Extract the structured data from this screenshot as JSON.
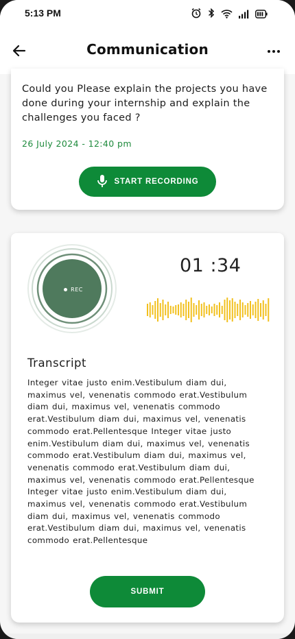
{
  "status_bar": {
    "time": "5:13 PM",
    "icons": [
      "alarm-icon",
      "bluetooth-icon",
      "wifi-icon",
      "signal-icon",
      "battery-icon"
    ]
  },
  "header": {
    "title": "Communication",
    "back_icon": "arrow-left-icon",
    "menu_icon": "more-horizontal-icon"
  },
  "question_card": {
    "question": "Could you Please explain the projects you have done during your internship and explain the challenges you faced ?",
    "timestamp": "26 July 2024 - 12:40 pm",
    "record_button_label": "START RECORDING",
    "record_icon": "microphone-icon"
  },
  "recording_card": {
    "rec_label": "REC",
    "timer": "01 :34",
    "transcript_heading": "Transcript",
    "transcript": "Integer vitae justo enim.Vestibulum diam dui, maximus  vel, venenatis commodo erat.Vestibulum diam dui, maximus  vel, venenatis commodo erat.Vestibulum diam dui, maximus  vel, venenatis commodo erat.Pellentesque Integer vitae justo enim.Vestibulum diam dui, maximus  vel, venenatis commodo erat.Vestibulum diam dui, maximus  vel, venenatis commodo erat.Vestibulum diam dui, maximus  vel, venenatis commodo erat.Pellentesque Integer vitae justo enim.Vestibulum diam dui, maximus  vel, venenatis commodo erat.Vestibulum diam dui, maximus  vel, venenatis commodo erat.Vestibulum diam dui, maximus  vel, venenatis commodo erat.Pellentesque",
    "submit_label": "SUBMIT"
  },
  "colors": {
    "accent": "#0e8a38",
    "timestamp": "#1e8a3c",
    "rec_circle": "#4f7a5d",
    "waveform": "#f2c01e"
  }
}
